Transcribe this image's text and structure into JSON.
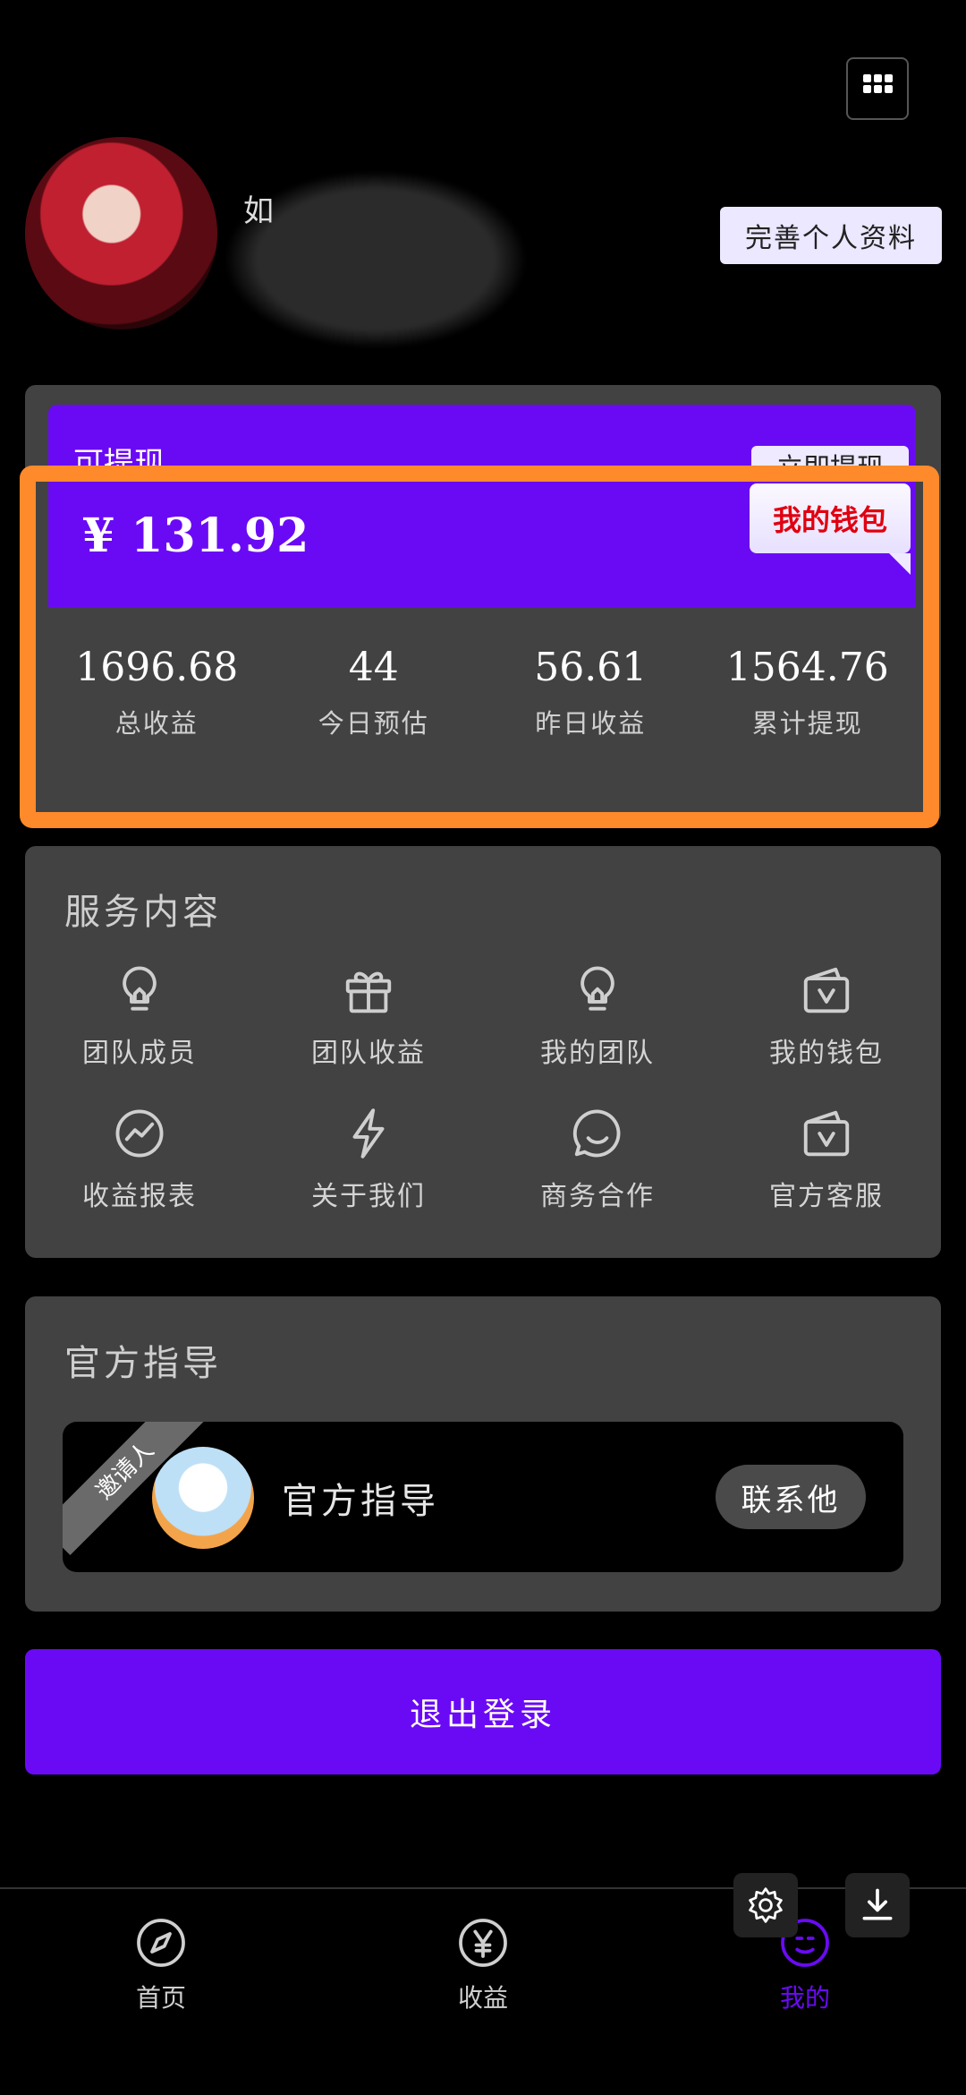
{
  "header": {
    "nickname": "如",
    "profile_button": "完善个人资料"
  },
  "wallet": {
    "withdrawable_label": "可提现",
    "withdraw_button": "立即提现",
    "balance": "¥ 131.92",
    "wallet_tag": "我的钱包",
    "stats": [
      {
        "value": "1696.68",
        "label": "总收益"
      },
      {
        "value": "44",
        "label": "今日预估"
      },
      {
        "value": "56.61",
        "label": "昨日收益"
      },
      {
        "value": "1564.76",
        "label": "累计提现"
      }
    ]
  },
  "services": {
    "title": "服务内容",
    "items": [
      {
        "label": "团队成员",
        "icon": "bulb-icon"
      },
      {
        "label": "团队收益",
        "icon": "gift-icon"
      },
      {
        "label": "我的团队",
        "icon": "bulb-icon"
      },
      {
        "label": "我的钱包",
        "icon": "wallet-icon"
      },
      {
        "label": "收益报表",
        "icon": "chart-icon"
      },
      {
        "label": "关于我们",
        "icon": "lightning-icon"
      },
      {
        "label": "商务合作",
        "icon": "chat-icon"
      },
      {
        "label": "官方客服",
        "icon": "wallet-icon"
      }
    ]
  },
  "guide": {
    "title": "官方指导",
    "ribbon": "邀请人",
    "name": "官方指导",
    "contact_button": "联系他"
  },
  "logout": "退出登录",
  "nav": {
    "items": [
      {
        "label": "首页",
        "icon": "compass-icon"
      },
      {
        "label": "收益",
        "icon": "yen-icon"
      },
      {
        "label": "我的",
        "icon": "profile-icon"
      }
    ]
  },
  "colors": {
    "accent": "#6a0af5",
    "highlight": "#ff8a2b",
    "card": "#424242",
    "wallet_tag_text": "#e00010"
  }
}
